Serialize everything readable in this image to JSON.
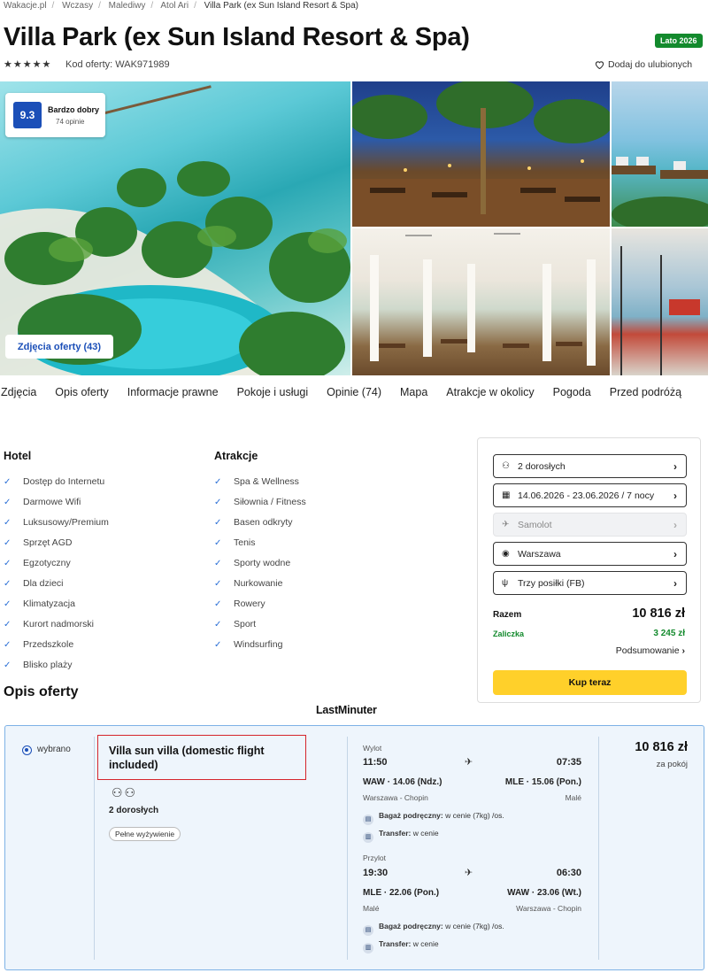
{
  "breadcrumb": [
    "Wakacje.pl",
    "Wczasy",
    "Malediwy",
    "Atol Ari",
    "Villa Park (ex Sun Island Resort & Spa)"
  ],
  "title": "Villa Park (ex Sun Island Resort & Spa)",
  "season_badge": "Lato 2026",
  "stars": "★★★★★",
  "offer_code": "Kod oferty: WAK971989",
  "favorite_label": "Dodaj do ulubionych",
  "rating": {
    "score": "9.3",
    "label": "Bardzo dobry",
    "count": "74 opinie"
  },
  "photos_button": "Zdjęcia oferty (43)",
  "tabs": [
    "Zdjęcia",
    "Opis oferty",
    "Informacje prawne",
    "Pokoje i usługi",
    "Opinie (74)",
    "Mapa",
    "Atrakcje w okolicy",
    "Pogoda",
    "Przed podróżą"
  ],
  "hotel": {
    "heading": "Hotel",
    "items": [
      "Dostęp do Internetu",
      "Darmowe Wifi",
      "Luksusowy/Premium",
      "Sprzęt AGD",
      "Egzotyczny",
      "Dla dzieci",
      "Klimatyzacja",
      "Kurort nadmorski",
      "Przedszkole",
      "Blisko plaży"
    ]
  },
  "attractions": {
    "heading": "Atrakcje",
    "items": [
      "Spa & Wellness",
      "Siłownia / Fitness",
      "Basen odkryty",
      "Tenis",
      "Sporty wodne",
      "Nurkowanie",
      "Rowery",
      "Sport",
      "Windsurfing"
    ]
  },
  "section_title": "Opis oferty",
  "booking": {
    "persons": "2 dorosłych",
    "dates": "14.06.2026 - 23.06.2026 / 7 nocy",
    "transport": "Samolot",
    "departure": "Warszawa",
    "board": "Trzy posiłki (FB)",
    "total_label": "Razem",
    "total_value": "10 816 zł",
    "deposit_label": "Zaliczka",
    "deposit_value": "3 245 zł",
    "summary_link": "Podsumowanie",
    "buy_button": "Kup teraz"
  },
  "provider_logo": "LastMinuter",
  "offer": {
    "selected_label": "wybrano",
    "room_name": "Villa sun villa (domestic flight included)",
    "adults": "2 dorosłych",
    "board_badge": "Pełne wyżywienie",
    "price": "10 816 zł",
    "price_note": "za pokój",
    "outbound": {
      "label": "Wylot",
      "dep_time": "11:50",
      "arr_time": "07:35",
      "dep_code": "WAW · 14.06 (Ndz.)",
      "arr_code": "MLE · 15.06 (Pon.)",
      "dep_city": "Warszawa - Chopin",
      "arr_city": "Malé"
    },
    "inbound": {
      "label": "Przylot",
      "dep_time": "19:30",
      "arr_time": "06:30",
      "dep_code": "MLE · 22.06 (Pon.)",
      "arr_code": "WAW · 23.06 (Wt.)",
      "dep_city": "Malé",
      "arr_city": "Warszawa - Chopin"
    },
    "baggage_label": "Bagaż podręczny:",
    "baggage_value": "w cenie (7kg) /os.",
    "transfer_label": "Transfer:",
    "transfer_value": "w cenie"
  }
}
